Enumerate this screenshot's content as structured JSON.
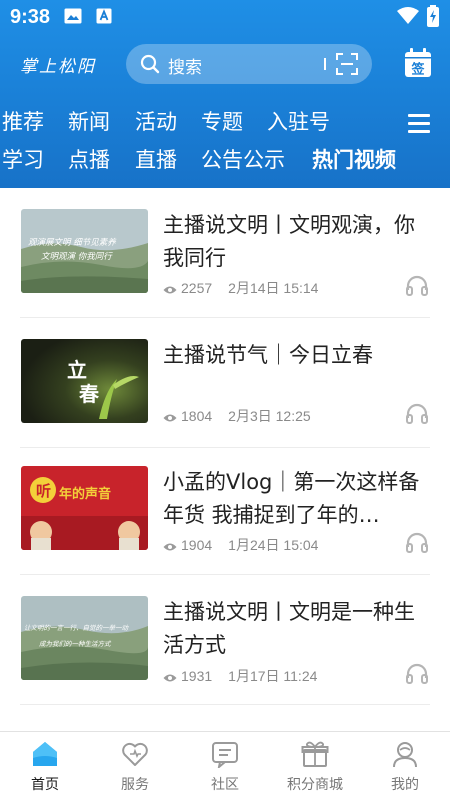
{
  "status": {
    "time": "9:38"
  },
  "header": {
    "logo": "掌上松阳",
    "search_placeholder": "搜索",
    "signin_label": "签"
  },
  "nav": {
    "row1": [
      "推荐",
      "新闻",
      "活动",
      "专题",
      "入驻号"
    ],
    "row2": [
      "学习",
      "点播",
      "直播",
      "公告公示",
      "热门视频"
    ],
    "active": "热门视频"
  },
  "thumbs": {
    "t1": [
      "观演展文明 细节见素养",
      "文明观演 你我同行"
    ],
    "t2": [
      "立",
      "春"
    ],
    "t3": [
      "听",
      "年的声音"
    ],
    "t4": [
      "让文明的一言一行、自觉的一举一动",
      "成为我们的一种生活方式"
    ]
  },
  "items": [
    {
      "title": "主播说文明丨文明观演，你我同行",
      "views": "2257",
      "date": "2月14日 15:14"
    },
    {
      "title": "主播说节气｜今日立春",
      "views": "1804",
      "date": "2月3日 12:25"
    },
    {
      "title": "小孟的Vlog｜第一次这样备年货 我捕捉到了年的…",
      "views": "1904",
      "date": "1月24日 15:04"
    },
    {
      "title": "主播说文明丨文明是一种生活方式",
      "views": "1931",
      "date": "1月17日 11:24"
    }
  ],
  "tabs": [
    {
      "label": "首页",
      "icon": "home-icon"
    },
    {
      "label": "服务",
      "icon": "heart-icon"
    },
    {
      "label": "社区",
      "icon": "chat-icon"
    },
    {
      "label": "积分商城",
      "icon": "gift-icon"
    },
    {
      "label": "我的",
      "icon": "user-icon"
    }
  ],
  "colors": {
    "header": "#1a7fd6",
    "accent": "#1e90e8",
    "meta": "#8a8a8a"
  }
}
